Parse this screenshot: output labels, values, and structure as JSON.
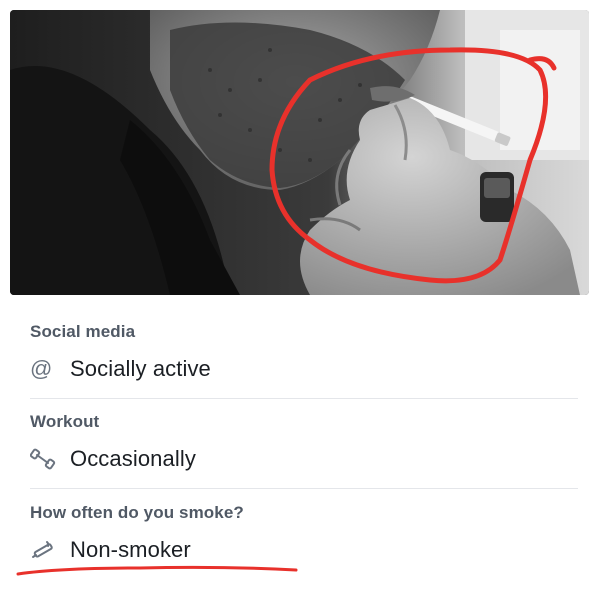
{
  "photo": {
    "alt_subject": "man-lighting-cigarette-photo"
  },
  "sections": [
    {
      "title": "Social media",
      "value": "Socially active",
      "icon": "at-sign-icon"
    },
    {
      "title": "Workout",
      "value": "Occasionally",
      "icon": "dumbbell-icon"
    },
    {
      "title": "How often do you smoke?",
      "value": "Non-smoker",
      "icon": "cigarette-icon"
    }
  ],
  "colors": {
    "annotation_red": "#e8312b",
    "title_gray": "#505965",
    "value_dark": "#1b1f24",
    "icon_gray": "#6b7480",
    "divider": "#e4e6ea"
  }
}
